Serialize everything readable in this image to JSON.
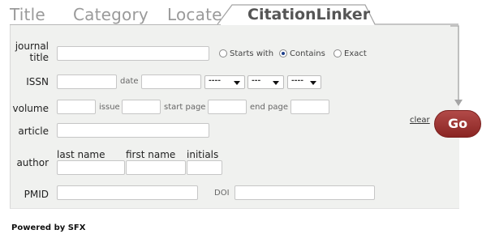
{
  "tabs": [
    {
      "label": "Title",
      "active": false
    },
    {
      "label": "Category",
      "active": false
    },
    {
      "label": "Locate",
      "active": false
    },
    {
      "label": "CitationLinker",
      "active": true
    }
  ],
  "form": {
    "journal_title": {
      "label_line1": "journal",
      "label_line2": "title",
      "value": "",
      "match_options": [
        {
          "label": "Starts with",
          "selected": false
        },
        {
          "label": "Contains",
          "selected": true
        },
        {
          "label": "Exact",
          "selected": false
        }
      ]
    },
    "issn": {
      "label": "ISSN",
      "value": ""
    },
    "date": {
      "label": "date",
      "value": "",
      "year_select": "----",
      "month_select": "---",
      "day_select": "----"
    },
    "volume": {
      "label": "volume",
      "value": ""
    },
    "issue": {
      "label": "issue",
      "value": ""
    },
    "start_page": {
      "label": "start page",
      "value": ""
    },
    "end_page": {
      "label": "end page",
      "value": ""
    },
    "article": {
      "label": "article",
      "value": ""
    },
    "author": {
      "label": "author",
      "last_name_label": "last name",
      "first_name_label": "first name",
      "initials_label": "initials"
    },
    "pmid": {
      "label": "PMID",
      "value": ""
    },
    "doi": {
      "label": "DOI",
      "value": ""
    }
  },
  "actions": {
    "clear_label": "clear",
    "go_label": "Go"
  },
  "footer": {
    "powered_by": "Powered by SFX"
  },
  "colors": {
    "panel_bg": "#f0f1ef",
    "go_button": "#9e3533",
    "tab_inactive": "#9a9a9a",
    "tab_active": "#555555"
  }
}
